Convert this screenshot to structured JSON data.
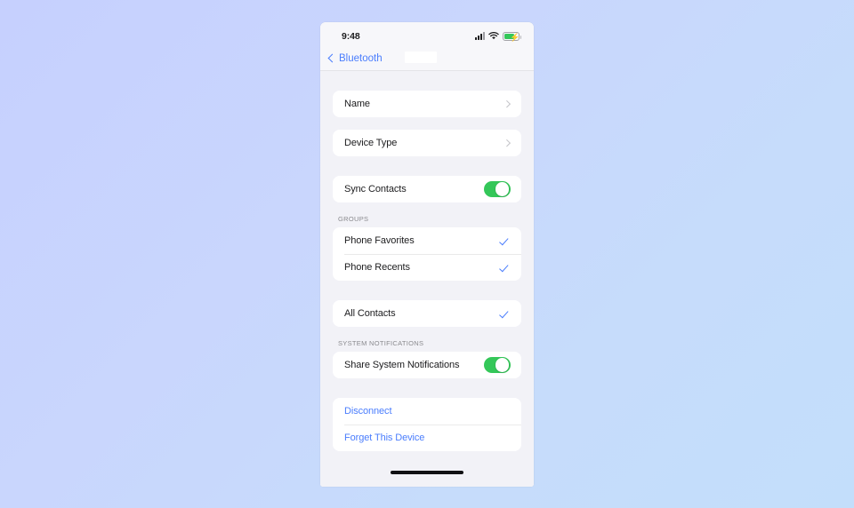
{
  "status_bar": {
    "time": "9:48",
    "signal_icon": "cellular-signal-icon",
    "wifi_icon": "wifi-icon",
    "battery_icon": "battery-charging-icon",
    "battery_color": "#34C759"
  },
  "nav_bar": {
    "back_label": "Bluetooth",
    "back_icon": "chevron-left-icon",
    "title": "",
    "title_redacted": true
  },
  "theme": {
    "accent_blue": "#4A7DFD",
    "toggle_green": "#34C759",
    "group_background": "#F2F2F7",
    "card_background": "#FFFFFF",
    "primary_text": "#1C1C1E",
    "secondary_text": "#8A8A8E"
  },
  "sections": [
    {
      "key": "name_section",
      "header": "",
      "rows": [
        {
          "key": "name",
          "label": "Name",
          "accessory": "chevron",
          "interactable": true
        }
      ]
    },
    {
      "key": "device_type_section",
      "header": "",
      "rows": [
        {
          "key": "device_type",
          "label": "Device Type",
          "accessory": "chevron",
          "interactable": true
        }
      ]
    },
    {
      "key": "sync_contacts_section",
      "header": "",
      "rows": [
        {
          "key": "sync_contacts",
          "label": "Sync Contacts",
          "accessory": "toggle",
          "value": "on",
          "interactable": true
        }
      ]
    },
    {
      "key": "groups_section",
      "header": "GROUPS",
      "rows": [
        {
          "key": "phone_favorites",
          "label": "Phone Favorites",
          "accessory": "checkmark",
          "value": "checked",
          "interactable": true
        },
        {
          "key": "phone_recents",
          "label": "Phone Recents",
          "accessory": "checkmark",
          "value": "checked",
          "interactable": true
        }
      ]
    },
    {
      "key": "all_contacts_section",
      "header": "",
      "rows": [
        {
          "key": "all_contacts",
          "label": "All Contacts",
          "accessory": "checkmark",
          "value": "checked",
          "interactable": true
        }
      ]
    },
    {
      "key": "system_notifications_section",
      "header": "SYSTEM NOTIFICATIONS",
      "rows": [
        {
          "key": "share_system_notifications",
          "label": "Share System Notifications",
          "accessory": "toggle",
          "value": "on",
          "interactable": true
        }
      ]
    },
    {
      "key": "actions_section",
      "header": "",
      "rows": [
        {
          "key": "disconnect",
          "label": "Disconnect",
          "accessory": "none",
          "style": "link",
          "interactable": true
        },
        {
          "key": "forget_this_device",
          "label": "Forget This Device",
          "accessory": "none",
          "style": "link",
          "interactable": true
        }
      ]
    }
  ],
  "home_indicator": "home-indicator"
}
